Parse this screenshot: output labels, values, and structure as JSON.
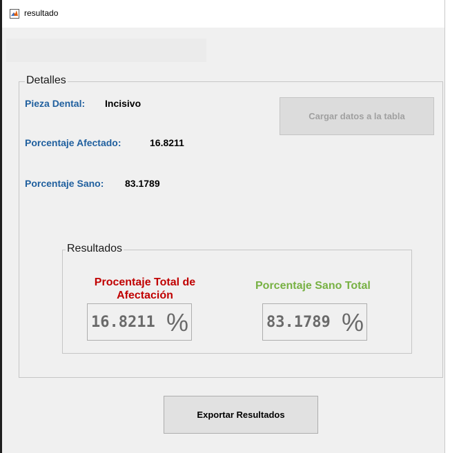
{
  "window": {
    "title": "resultado"
  },
  "detalles": {
    "title": "Detalles",
    "pieza_label": "Pieza Dental:",
    "pieza_value": "Incisivo",
    "afectado_label": "Porcentaje Afectado:",
    "afectado_value": "16.8211",
    "sano_label": "Porcentaje Sano:",
    "sano_value": "83.1789",
    "cargar_button": "Cargar datos a la tabla"
  },
  "resultados": {
    "title": "Resultados",
    "total_afectacion_title": "Procentaje Total de Afectación",
    "total_afectacion_value": "16.8211",
    "sano_total_title": "Porcentaje Sano Total",
    "sano_total_value": "83.1789",
    "percent_symbol": "%"
  },
  "footer": {
    "export_button": "Exportar Resultados"
  },
  "colors": {
    "label_blue": "#1f5f9e",
    "title_red": "#c00000",
    "title_green": "#77b143"
  },
  "icons": {
    "app_icon": "matlab-icon"
  }
}
